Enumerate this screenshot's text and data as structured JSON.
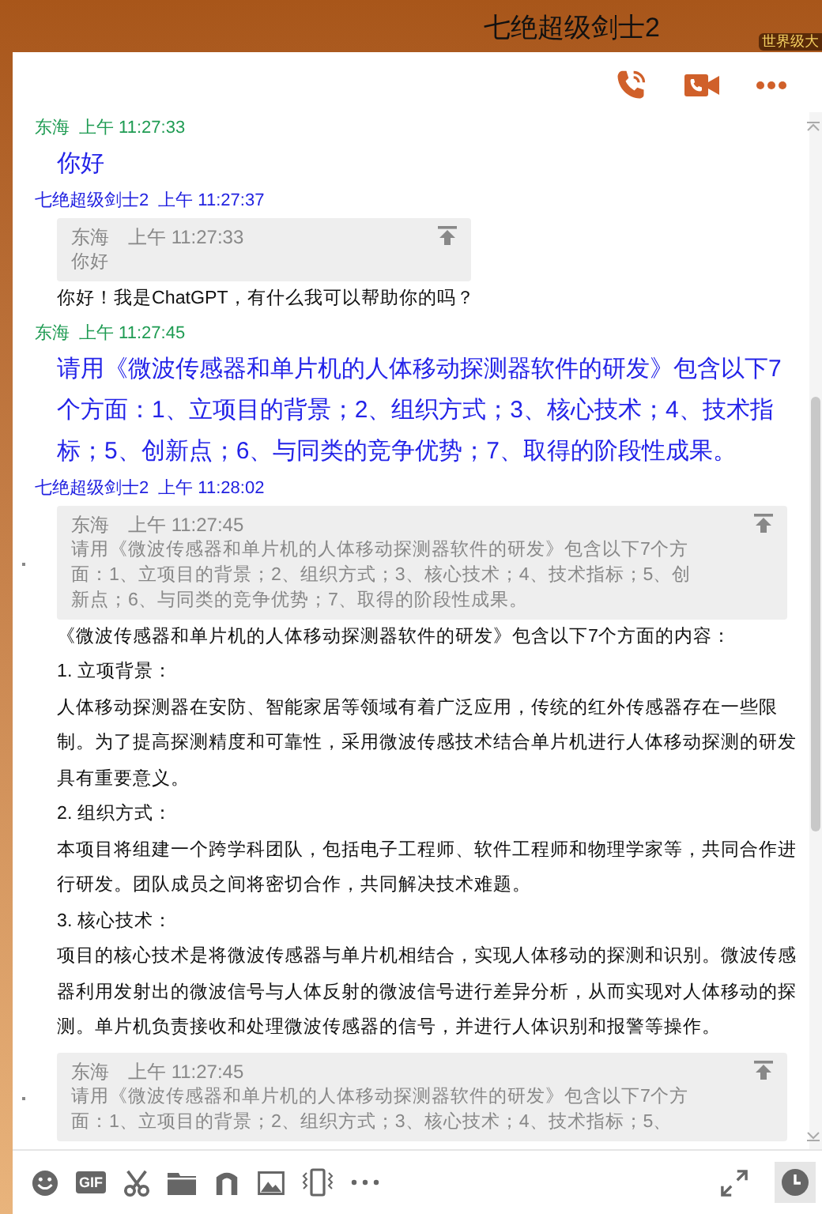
{
  "window": {
    "title": "七绝超级剑士2",
    "badge": "世界级大"
  },
  "messages": [
    {
      "self": true,
      "sender": "东海",
      "time": "上午 11:27:33",
      "kind": "text",
      "text": "你好"
    },
    {
      "self": false,
      "sender": "七绝超级剑士2",
      "time": "上午 11:27:37",
      "kind": "reply",
      "quote": {
        "sender": "东海",
        "time": "上午 11:27:33",
        "text": "你好"
      },
      "paragraphs": [
        "你好！我是ChatGPT，有什么我可以帮助你的吗？"
      ]
    },
    {
      "self": true,
      "sender": "东海",
      "time": "上午 11:27:45",
      "kind": "text",
      "text": "请用《微波传感器和单片机的人体移动探测器软件的研发》包含以下7个方面：1、立项目的背景；2、组织方式；3、核心技术；4、技术指标；5、创新点；6、与同类的竞争优势；7、取得的阶段性成果。"
    },
    {
      "self": false,
      "sender": "七绝超级剑士2",
      "time": "上午 11:28:02",
      "kind": "reply",
      "quote": {
        "sender": "东海",
        "time": "上午 11:27:45",
        "text": "请用《微波传感器和单片机的人体移动探测器软件的研发》包含以下7个方面：1、立项目的背景；2、组织方式；3、核心技术；4、技术指标；5、创新点；6、与同类的竞争优势；7、取得的阶段性成果。"
      },
      "paragraphs": [
        "《微波传感器和单片机的人体移动探测器软件的研发》包含以下7个方面的内容：",
        "1. 立项背景：",
        "人体移动探测器在安防、智能家居等领域有着广泛应用，传统的红外传感器存在一些限制。为了提高探测精度和可靠性，采用微波传感技术结合单片机进行人体移动探测的研发具有重要意义。",
        "2. 组织方式：",
        "本项目将组建一个跨学科团队，包括电子工程师、软件工程师和物理学家等，共同合作进行研发。团队成员之间将密切合作，共同解决技术难题。",
        "3. 核心技术：",
        "项目的核心技术是将微波传感器与单片机相结合，实现人体移动的探测和识别。微波传感器利用发射出的微波信号与人体反射的微波信号进行差异分析，从而实现对人体移动的探测。单片机负责接收和处理微波传感器的信号，并进行人体识别和报警等操作。"
      ]
    },
    {
      "kind": "reply",
      "quote": {
        "sender": "东海",
        "time": "上午 11:27:45",
        "text": "请用《微波传感器和单片机的人体移动探测器软件的研发》包含以下7个方面：1、立项目的背景；2、组织方式；3、核心技术；4、技术指标；5、"
      }
    }
  ],
  "toolbar": {
    "gif_label": "GIF"
  }
}
